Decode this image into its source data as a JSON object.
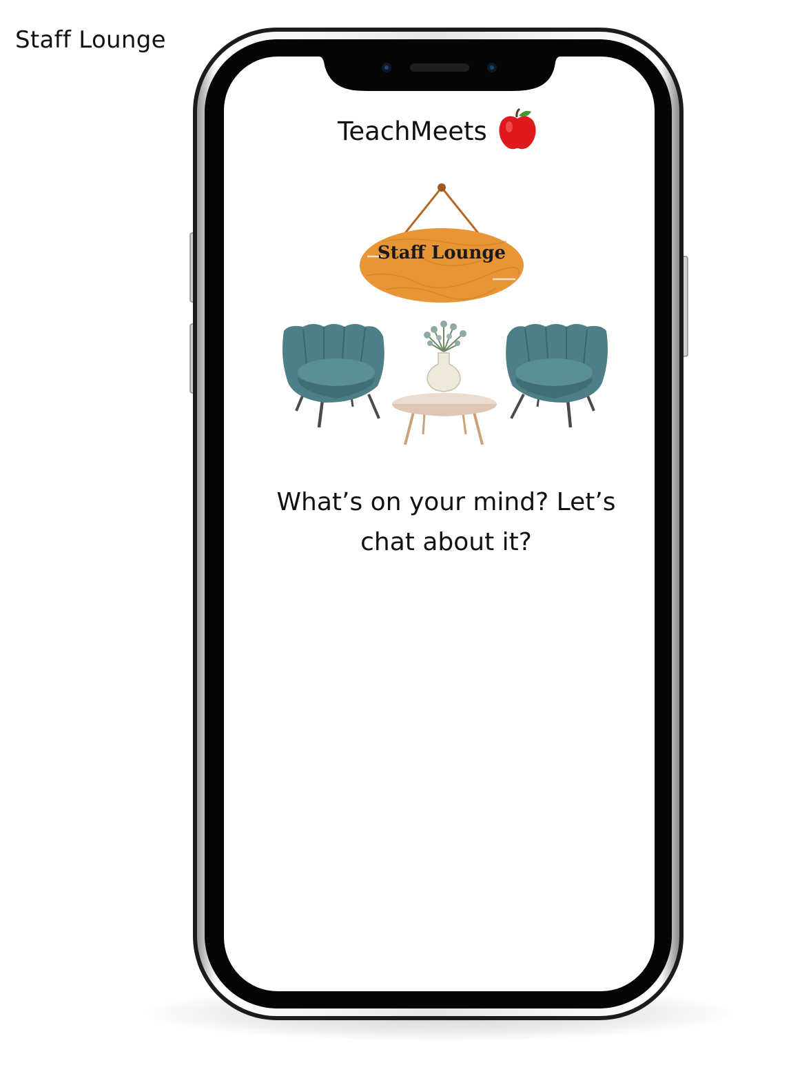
{
  "page_label": "Staff Lounge",
  "app": {
    "title": "TeachMeets",
    "logo_icon": "apple-icon"
  },
  "lounge_sign": {
    "text": "Staff Lounge",
    "color": "#e89535"
  },
  "illustration": {
    "chair_color": "#4d7f86",
    "table_color": "#ecdccf",
    "icons": [
      "armchair-icon",
      "vase-icon",
      "coffee-table-icon",
      "armchair-icon"
    ]
  },
  "prompt": {
    "line1": "What’s on your mind? Let’s",
    "line2": "chat about it?"
  }
}
